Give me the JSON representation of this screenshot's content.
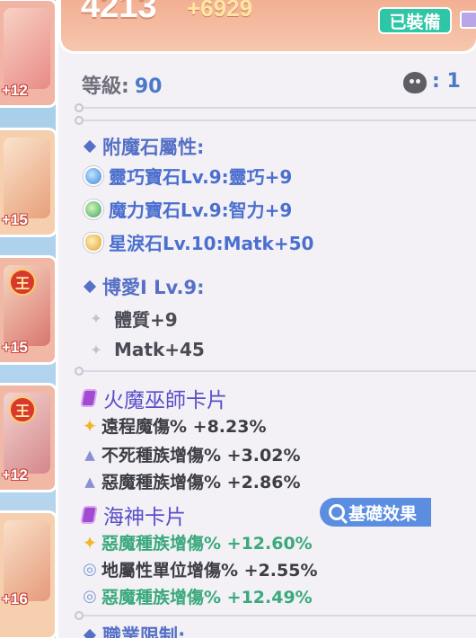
{
  "slots": [
    {
      "level": "+12"
    },
    {
      "level": "+15"
    },
    {
      "level": "+15",
      "badge": "王"
    },
    {
      "level": "+12",
      "badge": "王"
    },
    {
      "level": "+16"
    }
  ],
  "header": {
    "power": "4213",
    "power_bonus": "+6929",
    "equipped_label": "已裝備"
  },
  "level": {
    "label": "等級:",
    "value": "90",
    "slot_count": ": 1"
  },
  "enchant": {
    "title": "附魔石屬性:",
    "items": [
      {
        "text": "靈巧寶石Lv.9:靈巧+9",
        "gem": "blue"
      },
      {
        "text": "魔力寶石Lv.9:智力+9",
        "gem": "green"
      },
      {
        "text": "星淚石Lv.10:Matk+50",
        "gem": "gold"
      }
    ]
  },
  "refine": {
    "title": "博愛I Lv.9:",
    "items": [
      "體質+9",
      "Matk+45"
    ]
  },
  "cards": [
    {
      "title": "火魔巫師卡片",
      "stats": [
        {
          "text": "遠程魔傷% +8.23%",
          "icon": "star",
          "color": "dark"
        },
        {
          "text": "不死種族增傷% +3.02%",
          "icon": "triangle",
          "color": "dark"
        },
        {
          "text": "惡魔種族增傷% +2.86%",
          "icon": "triangle",
          "color": "dark"
        }
      ]
    },
    {
      "title": "海神卡片",
      "stats": [
        {
          "text": "惡魔種族增傷% +12.60%",
          "icon": "star",
          "color": "green"
        },
        {
          "text": "地屬性單位增傷% +2.55%",
          "icon": "swirl",
          "color": "dark"
        },
        {
          "text": "惡魔種族增傷% +12.49%",
          "icon": "swirl",
          "color": "green"
        }
      ]
    }
  ],
  "basic_effect_button": "基礎效果",
  "job_restriction_title": "職業限制:",
  "colors": {
    "accent_blue": "#4b6fcf",
    "equipped_green": "#2ec6a6",
    "stat_green": "#3aa97c",
    "card_purple": "#a24bd1"
  }
}
